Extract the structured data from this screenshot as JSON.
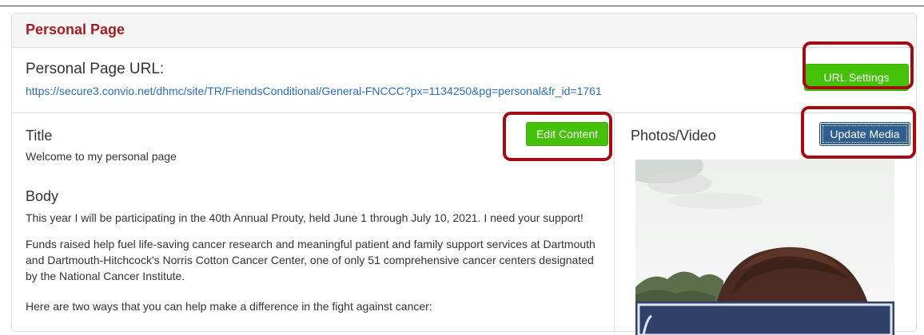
{
  "panel": {
    "title": "Personal Page"
  },
  "url_section": {
    "label": "Personal Page URL:",
    "url": "https://secure3.convio.net/dhmc/site/TR/FriendsConditional/General-FNCCC?px=1134250&pg=personal&fr_id=1761",
    "settings_button": "URL Settings"
  },
  "content": {
    "title_heading": "Title",
    "title_value": "Welcome to my personal page",
    "edit_button": "Edit Content",
    "body_heading": "Body",
    "paragraphs": [
      "This year I will be participating in the 40th Annual Prouty, held June 1 through July 10, 2021. I need your support!",
      "Funds raised help fuel life-saving cancer research and meaningful patient and family support services at Dartmouth and Dartmouth-Hitchcock's Norris Cotton Cancer Center, one of only 51 comprehensive cancer centers designated by the National Cancer Institute.",
      "Here are two ways that you can help make a difference in the fight against cancer:"
    ]
  },
  "media": {
    "heading": "Photos/Video",
    "update_button": "Update Media"
  },
  "colors": {
    "title_red": "#a31f1f",
    "link_blue": "#2a6ebb",
    "button_green": "#44c108",
    "button_blue": "#2f5f8f",
    "highlight_red": "#a20c14"
  }
}
